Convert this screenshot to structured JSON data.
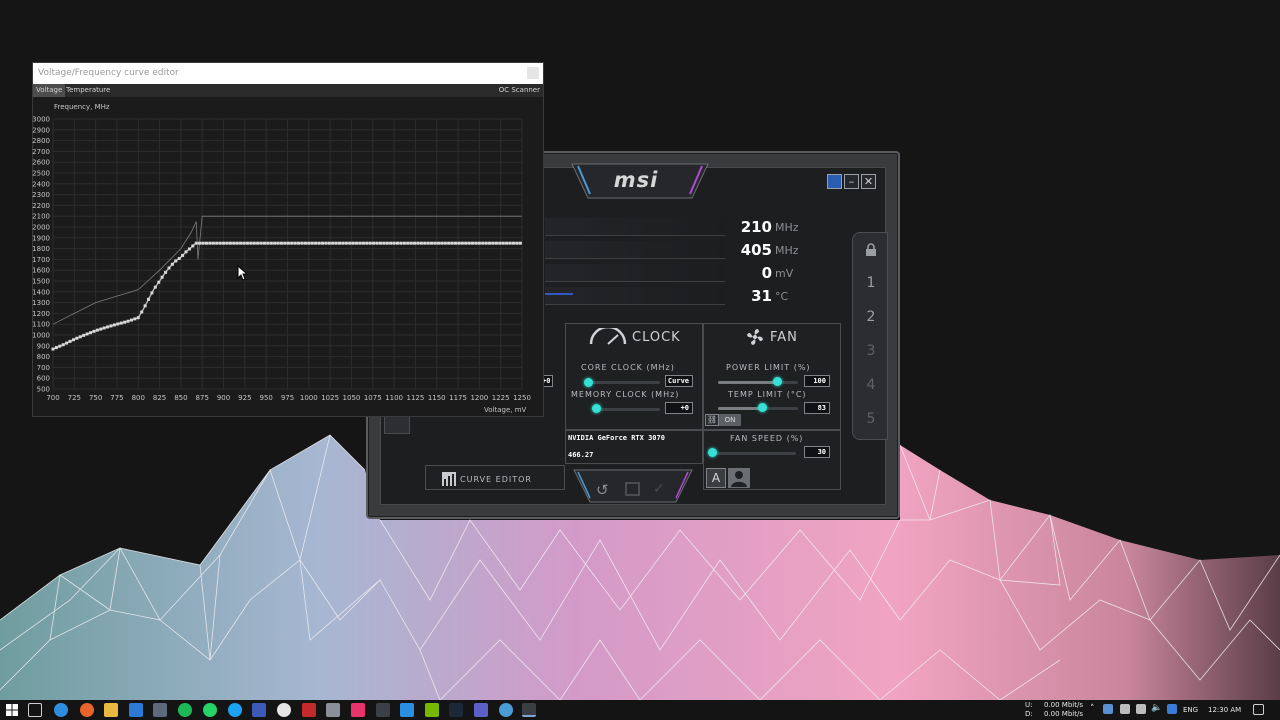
{
  "curve_editor": {
    "title": "Voltage/Frequency curve editor",
    "tabs": [
      "Voltage",
      "Temperature"
    ],
    "active_tab": "Voltage",
    "oc_scanner_label": "OC Scanner",
    "y_axis_label": "Frequency, MHz",
    "x_axis_label": "Voltage, mV",
    "chart_data": {
      "type": "line",
      "xlabel": "Voltage, mV",
      "ylabel": "Frequency, MHz",
      "xlim": [
        700,
        1250
      ],
      "ylim": [
        500,
        3000
      ],
      "x_ticks": [
        "700",
        "725",
        "750",
        "775",
        "800",
        "825",
        "850",
        "875",
        "900",
        "925",
        "950",
        "975",
        "1000",
        "1025",
        "1050",
        "1075",
        "1100",
        "1125",
        "1150",
        "1175",
        "1200",
        "1225",
        "1250"
      ],
      "y_ticks": [
        "3000",
        "2900",
        "2800",
        "2700",
        "2600",
        "2500",
        "2400",
        "2300",
        "2200",
        "2100",
        "2000",
        "1900",
        "1800",
        "1700",
        "1600",
        "1500",
        "1400",
        "1300",
        "1200",
        "1100",
        "1000",
        "900",
        "800",
        "700",
        "600",
        "500"
      ],
      "grid": true,
      "series": [
        {
          "line": "curve-points",
          "x": [
            700,
            712,
            725,
            737,
            750,
            762,
            775,
            787,
            800,
            806,
            812,
            818,
            825,
            831,
            837,
            843,
            850,
            856,
            862,
            866,
            868,
            875,
            900,
            950,
            1000,
            1050,
            1100,
            1150,
            1200,
            1250
          ],
          "y": [
            870,
            910,
            960,
            1000,
            1040,
            1070,
            1100,
            1125,
            1160,
            1240,
            1330,
            1420,
            1500,
            1570,
            1630,
            1680,
            1720,
            1770,
            1810,
            1840,
            1850,
            1850,
            1850,
            1850,
            1850,
            1850,
            1850,
            1850,
            1850,
            1850
          ]
        },
        {
          "line": "default-curve",
          "x": [
            700,
            725,
            750,
            775,
            800,
            825,
            850,
            862,
            868,
            870,
            875,
            900,
            1000,
            1100,
            1200,
            1250
          ],
          "y": [
            1100,
            1200,
            1300,
            1360,
            1420,
            1600,
            1800,
            1950,
            2050,
            1700,
            2100,
            2100,
            2100,
            2100,
            2100,
            2100
          ]
        }
      ]
    }
  },
  "afterburner": {
    "logo": "msi",
    "stats": [
      {
        "value": "210",
        "unit": "MHz"
      },
      {
        "value": "405",
        "unit": "MHz"
      },
      {
        "value": "0",
        "unit": "mV"
      },
      {
        "value": "31",
        "unit": "°C"
      }
    ],
    "profiles": [
      "1",
      "2",
      "3",
      "4",
      "5"
    ],
    "clock_header": "CLOCK",
    "fan_header": "FAN",
    "core_clock_label": "CORE CLOCK (MHz)",
    "core_clock_value": "Curve",
    "memory_clock_label": "MEMORY CLOCK (MHz)",
    "memory_clock_value": "+0",
    "power_limit_label": "POWER LIMIT (%)",
    "power_limit_value": "100",
    "temp_limit_label": "TEMP LIMIT (°C)",
    "temp_limit_value": "83",
    "link_toggle": "ON",
    "fan_speed_label": "FAN SPEED (%)",
    "fan_speed_value": "30",
    "fan_mode_auto": "A",
    "gpu_name": "NVIDIA GeForce RTX 3070",
    "driver_version": "466.27",
    "curve_editor_button": "CURVE EDITOR",
    "partial_value": "+0",
    "sliders": {
      "core_clock": 0.0,
      "memory_clock": 0.0,
      "power_limit": 0.74,
      "temp_limit": 0.55,
      "fan_speed": 0.0
    },
    "accent_color": "#35e0d4"
  },
  "taskbar": {
    "network_up": "0.00 Mbit/s",
    "network_down": "0.00 Mbit/s",
    "network_up_label": "U:",
    "network_down_label": "D:",
    "language": "ENG",
    "time": "12:30 AM"
  }
}
